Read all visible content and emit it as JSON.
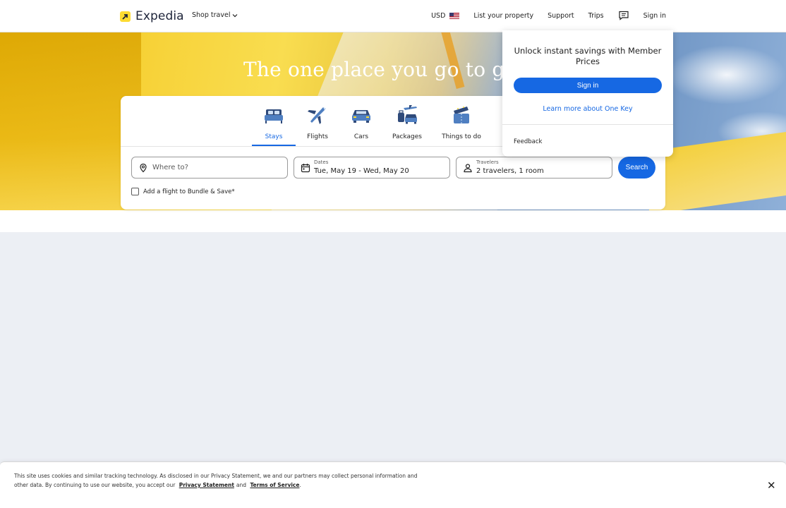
{
  "header": {
    "logo_text": "Expedia",
    "shop_travel": "Shop travel",
    "currency": "USD",
    "list_property": "List your property",
    "support": "Support",
    "trips": "Trips",
    "sign_in": "Sign in"
  },
  "hero": {
    "title": "The one place you go to go pl"
  },
  "tabs": [
    {
      "label": "Stays",
      "icon": "bed-icon",
      "active": true
    },
    {
      "label": "Flights",
      "icon": "plane-icon"
    },
    {
      "label": "Cars",
      "icon": "car-icon"
    },
    {
      "label": "Packages",
      "icon": "packages-icon"
    },
    {
      "label": "Things to do",
      "icon": "ticket-icon"
    }
  ],
  "search": {
    "where_placeholder": "Where to?",
    "dates_label": "Dates",
    "dates_value": "Tue, May 19 - Wed, May 20",
    "travelers_label": "Travelers",
    "travelers_value": "2 travelers, 1 room",
    "search_button": "Search",
    "bundle_label": "Add a flight to Bundle & Save*"
  },
  "signin_popup": {
    "title": "Unlock instant savings with Member Prices",
    "sign_in_button": "Sign in",
    "learn_more": "Learn more about One Key",
    "feedback": "Feedback"
  },
  "cookie": {
    "text1": "This site uses cookies and similar tracking technology. As disclosed in our Privacy Statement, we and our partners may collect personal information and other data. By continuing to use our website, you accept our",
    "privacy_link": "Privacy Statement",
    "and": "and",
    "terms_link": "Terms of Service",
    "period": ".",
    "close": "✕"
  },
  "colors": {
    "brand_blue": "#1668e3",
    "logo_yellow": "#fddb32",
    "page_bg": "#eceff4"
  }
}
